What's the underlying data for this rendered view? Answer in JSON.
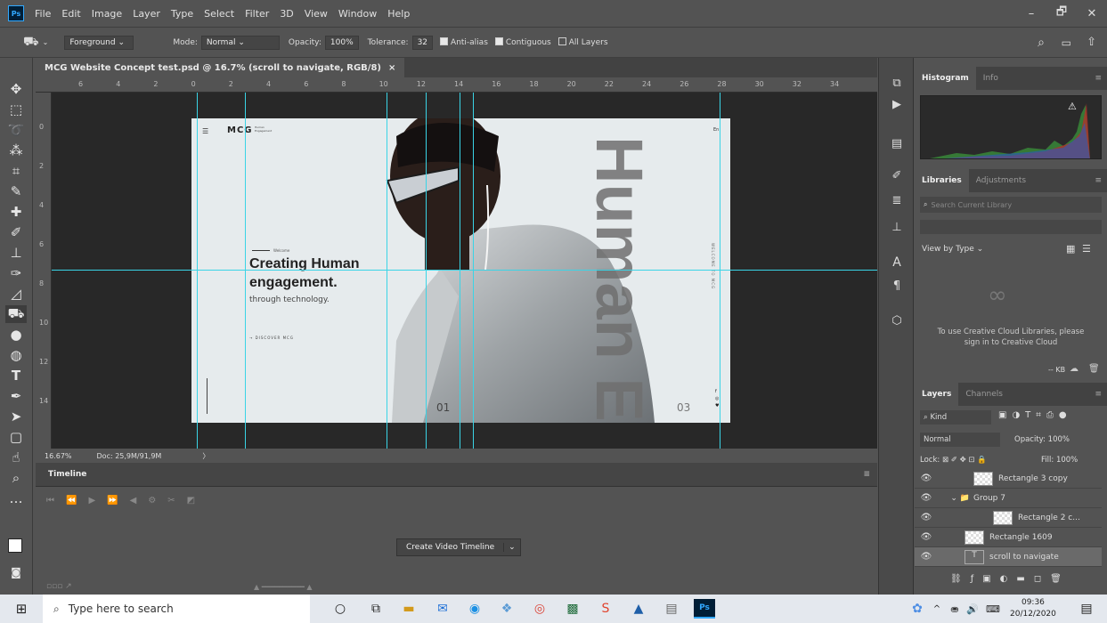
{
  "app": {
    "logo": "Ps"
  },
  "menu": [
    "File",
    "Edit",
    "Image",
    "Layer",
    "Type",
    "Select",
    "Filter",
    "3D",
    "View",
    "Window",
    "Help"
  ],
  "window_controls": {
    "minimize": "–",
    "restore": "🗗",
    "close": "✕"
  },
  "options": {
    "preset": "Foreground",
    "mode_label": "Mode:",
    "mode_value": "Normal",
    "opacity_label": "Opacity:",
    "opacity_value": "100%",
    "tolerance_label": "Tolerance:",
    "tolerance_value": "32",
    "anti_alias": "Anti-alias",
    "contiguous": "Contiguous",
    "all_layers": "All Layers"
  },
  "document": {
    "tab_title": "MCG Website Concept test.psd @ 16.7% (scroll to navigate, RGB/8)",
    "tab_close": "×",
    "ruler_h": [
      "6",
      "4",
      "2",
      "0",
      "2",
      "4",
      "6",
      "8",
      "10",
      "12",
      "14",
      "16",
      "18",
      "20",
      "22",
      "24",
      "26",
      "28",
      "30",
      "32",
      "34"
    ],
    "ruler_v": [
      "0",
      "2",
      "4",
      "6",
      "8",
      "10",
      "12",
      "14"
    ],
    "zoom": "16.67%",
    "doc_size": "Doc: 25,9M/91,9M"
  },
  "artboard": {
    "brand": "MCG",
    "brand_sub": "Human\nEngagement",
    "lang": "En",
    "welcome": "Welcome",
    "headline_1": "Creating Human",
    "headline_2": "engagement.",
    "subline": "through technology.",
    "cta": "DISCOVER MCG",
    "big_text": "Human Engag",
    "side_text": "WELCOME TO MCG",
    "slide_a": "01",
    "slide_b": "03",
    "social": [
      "f",
      "◎",
      "♥"
    ]
  },
  "timeline": {
    "title": "Timeline",
    "create_button": "Create Video Timeline"
  },
  "panels": {
    "histogram_tab": "Histogram",
    "info_tab": "Info",
    "libraries_tab": "Libraries",
    "adjustments_tab": "Adjustments",
    "search_placeholder": "Search Current Library",
    "view_by": "View by Type",
    "cc_message": "To use Creative Cloud Libraries, please sign in to Creative Cloud",
    "kb": "-- KB",
    "layers_tab": "Layers",
    "channels_tab": "Channels",
    "kind": "Kind",
    "blend": "Normal",
    "opacity_label": "Opacity:",
    "opacity_value": "100%",
    "lock_label": "Lock:",
    "fill_label": "Fill:",
    "fill_value": "100%",
    "layers": [
      "Rectangle 3 copy",
      "Group 7",
      "Rectangle 2 c...",
      "Rectangle 1609",
      "scroll to navigate"
    ]
  },
  "taskbar": {
    "search_placeholder": "Type here to search",
    "time": "09:36",
    "date": "20/12/2020"
  },
  "colors": {
    "guide": "#3ad4e6",
    "ps_blue": "#31a8ff"
  }
}
